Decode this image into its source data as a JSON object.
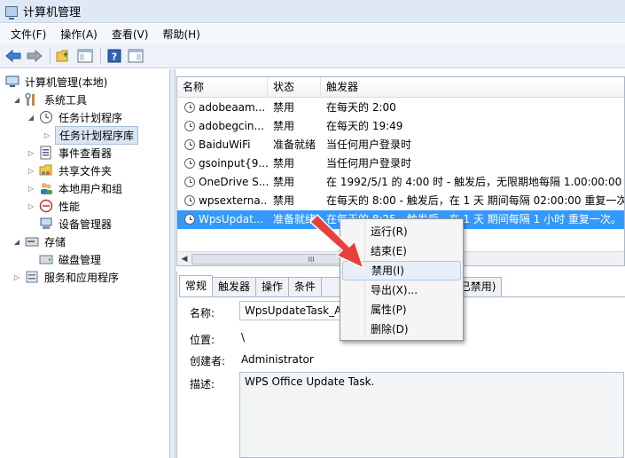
{
  "window": {
    "title": "计算机管理"
  },
  "menu": [
    "文件(F)",
    "操作(A)",
    "查看(V)",
    "帮助(H)"
  ],
  "tree": [
    {
      "label": "计算机管理(本地)",
      "icon": "computer-icon",
      "expander": "",
      "depth": 0
    },
    {
      "label": "系统工具",
      "icon": "tools-icon",
      "expander": "◢",
      "depth": 1
    },
    {
      "label": "任务计划程序",
      "icon": "clock-icon",
      "expander": "◢",
      "depth": 2
    },
    {
      "label": "任务计划程序库",
      "icon": "folder-icon",
      "expander": "▷",
      "depth": 3,
      "selected": true
    },
    {
      "label": "事件查看器",
      "icon": "event-viewer-icon",
      "expander": "▷",
      "depth": 2
    },
    {
      "label": "共享文件夹",
      "icon": "shared-folder-icon",
      "expander": "▷",
      "depth": 2
    },
    {
      "label": "本地用户和组",
      "icon": "users-icon",
      "expander": "▷",
      "depth": 2
    },
    {
      "label": "性能",
      "icon": "performance-icon",
      "expander": "▷",
      "depth": 2
    },
    {
      "label": "设备管理器",
      "icon": "device-manager-icon",
      "expander": "",
      "depth": 2
    },
    {
      "label": "存储",
      "icon": "storage-icon",
      "expander": "◢",
      "depth": 1
    },
    {
      "label": "磁盘管理",
      "icon": "disk-icon",
      "expander": "",
      "depth": 2
    },
    {
      "label": "服务和应用程序",
      "icon": "services-icon",
      "expander": "▷",
      "depth": 1
    }
  ],
  "list": {
    "columns": [
      "名称",
      "状态",
      "触发器"
    ],
    "rows": [
      {
        "name": "adobeaam...",
        "status": "禁用",
        "trigger": "在每天的 2:00"
      },
      {
        "name": "adobegcin...",
        "status": "禁用",
        "trigger": "在每天的 19:49"
      },
      {
        "name": "BaiduWiFi",
        "status": "准备就绪",
        "trigger": "当任何用户登录时"
      },
      {
        "name": "gsoinput{9...",
        "status": "禁用",
        "trigger": "当任何用户登录时"
      },
      {
        "name": "OneDrive S...",
        "status": "禁用",
        "trigger": "在 1992/5/1 的 4:00 时 - 触发后，无限期地每隔 1.00:00:00 重"
      },
      {
        "name": "wpsexterna...",
        "status": "禁用",
        "trigger": "在每天的 8:00 - 触发后，在 1 天 期间每隔 02:00:00 重复一次。"
      },
      {
        "name": "WpsUpdat...",
        "status": "准备就绪",
        "trigger": "在每天的 8:25 - 触发后，在 1 天 期间每隔 1 小时 重复一次。",
        "selected": true
      }
    ],
    "scroll_thumb_glyph": "III"
  },
  "detail": {
    "tabs": [
      "常规",
      "触发器",
      "操作",
      "条件",
      "",
      "史记录(已禁用)"
    ],
    "fields": {
      "name_label": "名称:",
      "name_value": "WpsUpdateTask_A",
      "location_label": "位置:",
      "location_value": "\\",
      "author_label": "创建者:",
      "author_value": "Administrator",
      "desc_label": "描述:",
      "desc_value": "WPS Office Update Task."
    }
  },
  "context_menu": {
    "items": [
      "运行(R)",
      "结束(E)",
      "禁用(I)",
      "导出(X)...",
      "属性(P)",
      "删除(D)"
    ],
    "hover_index": 2
  },
  "colors": {
    "selection": "#3399ff",
    "arrow": "#e8413c"
  }
}
